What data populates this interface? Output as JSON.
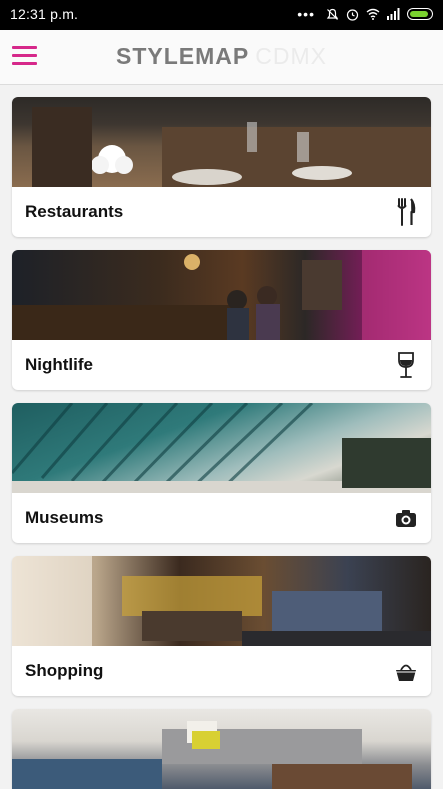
{
  "status_bar": {
    "time": "12:31 p.m.",
    "overflow_dots": "•••"
  },
  "app_bar": {
    "brand_main": "STYLEMAP",
    "brand_sub": "CDMX"
  },
  "categories": [
    {
      "label": "Restaurants",
      "icon": "fork-knife-icon"
    },
    {
      "label": "Nightlife",
      "icon": "wine-glass-icon"
    },
    {
      "label": "Museums",
      "icon": "camera-icon"
    },
    {
      "label": "Shopping",
      "icon": "shopping-basket-icon"
    }
  ],
  "colors": {
    "accent": "#d6288a",
    "status_bar": "#000000",
    "battery": "#7ad12f",
    "brand_text": "#7a7a7a"
  }
}
